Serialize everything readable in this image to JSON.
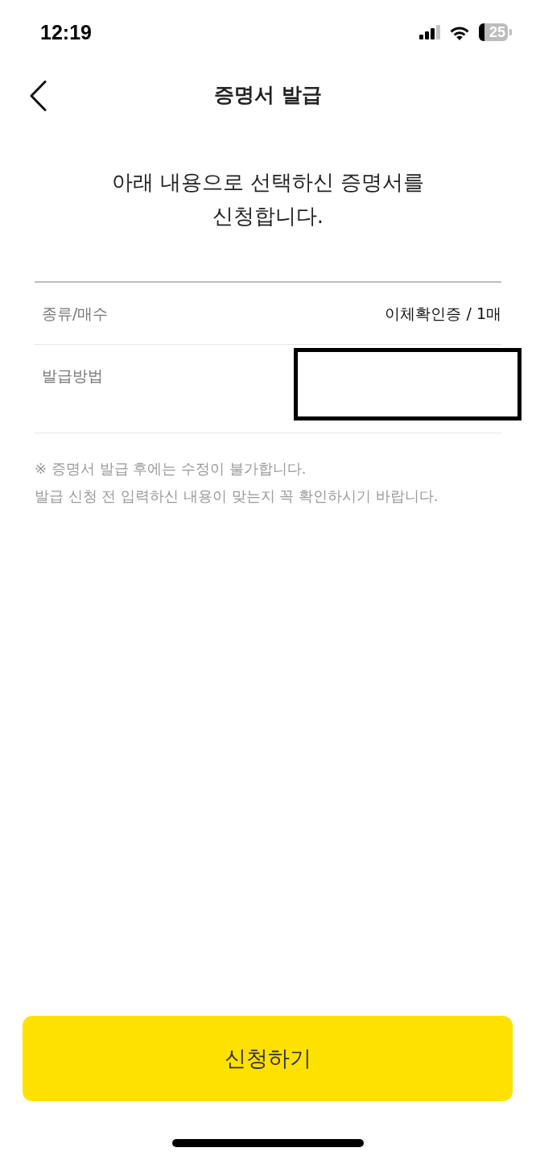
{
  "status_bar": {
    "time": "12:19",
    "battery": "25"
  },
  "header": {
    "title": "증명서 발급"
  },
  "intro": "아래 내용으로 선택하신 증명서를 신청합니다.",
  "rows": [
    {
      "label": "종류/매수",
      "value": "이체확인증 / 1매",
      "redacted": false
    },
    {
      "label": "발급방법",
      "redacted": true
    }
  ],
  "notes": [
    "※ 증명서 발급 후에는 수정이 불가합니다.",
    "발급 신청 전 입력하신 내용이 맞는지 꼭 확인하시기 바랍니다."
  ],
  "submit_button": {
    "label": "신청하기"
  }
}
